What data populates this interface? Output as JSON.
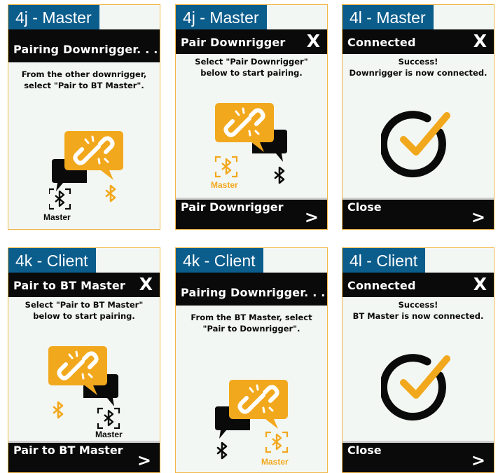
{
  "colors": {
    "tag_bg": "#0b5d8c",
    "accent": "#f2a81d",
    "header_bg": "#0a0a0a",
    "screen_bg": "#f3f7f3",
    "border": "#f2b84b"
  },
  "panels": [
    {
      "tag": "4j - Master",
      "header": "Pairing Downrigger. . .",
      "close": "",
      "message": [
        "From the other downrigger,",
        "select \"Pair to BT Master\"."
      ],
      "caption": "Master",
      "footer": "",
      "arrow": ""
    },
    {
      "tag": "4j - Master",
      "header": "Pair Downrigger",
      "close": "X",
      "message": [
        "Select \"Pair Downrigger\"",
        "below to start pairing."
      ],
      "caption": "Master",
      "footer": "Pair Downrigger",
      "arrow": ">"
    },
    {
      "tag": "4l - Master",
      "header": "Connected",
      "close": "X",
      "message": [
        "Success!",
        "Downrigger is now connected."
      ],
      "caption": "",
      "footer": "Close",
      "arrow": ">"
    },
    {
      "tag": "4k - Client",
      "header": "Pair to BT Master",
      "close": "X",
      "message": [
        "Select \"Pair to BT Master\"",
        "below to start pairing."
      ],
      "caption": "Master",
      "footer": "Pair to BT Master",
      "arrow": ">"
    },
    {
      "tag": "4k - Client",
      "header": "Pairing Downrigger. . .",
      "close": "",
      "message": [
        "From the BT Master, select",
        "\"Pair to Downrigger\"."
      ],
      "caption": "Master",
      "footer": "",
      "arrow": ""
    },
    {
      "tag": "4l - Client",
      "header": "Connected",
      "close": "X",
      "message": [
        "Success!",
        "BT Master is now connected."
      ],
      "caption": "",
      "footer": "Close",
      "arrow": ">"
    }
  ],
  "icons": {
    "pair": "pairing-bubbles-icon",
    "bluetooth": "bluetooth-icon",
    "success": "checkmark-circle-icon",
    "close": "close-icon",
    "next": "chevron-right-icon"
  }
}
